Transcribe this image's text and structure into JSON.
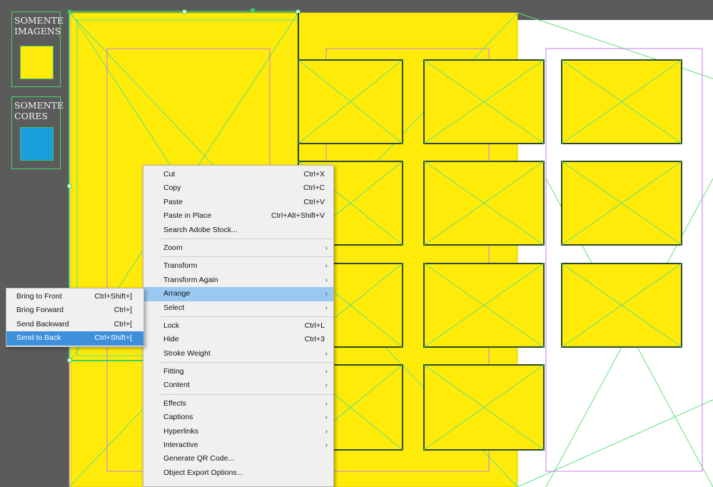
{
  "colors": {
    "pasteboard": "#5b5b5b",
    "page": "#ffffff",
    "frame_fill": "#ffeb0a",
    "frame_stroke": "#2a4a2a",
    "guide": "#5fe07f",
    "margin": "#c978f0",
    "cyan": "#19a0dc",
    "menu_bg": "#f0f0f0",
    "menu_highlight": "#99c8f0",
    "submenu_highlight": "#3d8fdc"
  },
  "swatches": {
    "images_label_line1": "SOMENTE",
    "images_label_line2": "IMAGENS",
    "colors_label_line1": "SOMENTE",
    "colors_label_line2": "CORES"
  },
  "context_menu": {
    "groups": [
      [
        {
          "label": "Cut",
          "shortcut": "Ctrl+X"
        },
        {
          "label": "Copy",
          "shortcut": "Ctrl+C"
        },
        {
          "label": "Paste",
          "shortcut": "Ctrl+V"
        },
        {
          "label": "Paste in Place",
          "shortcut": "Ctrl+Alt+Shift+V"
        },
        {
          "label": "Search Adobe Stock...",
          "shortcut": ""
        }
      ],
      [
        {
          "label": "Zoom",
          "submenu": true
        }
      ],
      [
        {
          "label": "Transform",
          "submenu": true
        },
        {
          "label": "Transform Again",
          "submenu": true
        },
        {
          "label": "Arrange",
          "submenu": true,
          "highlighted": true
        },
        {
          "label": "Select",
          "submenu": true
        }
      ],
      [
        {
          "label": "Lock",
          "shortcut": "Ctrl+L"
        },
        {
          "label": "Hide",
          "shortcut": "Ctrl+3"
        },
        {
          "label": "Stroke Weight",
          "submenu": true
        }
      ],
      [
        {
          "label": "Fitting",
          "submenu": true
        },
        {
          "label": "Content",
          "submenu": true
        }
      ],
      [
        {
          "label": "Effects",
          "submenu": true
        },
        {
          "label": "Captions",
          "submenu": true
        },
        {
          "label": "Hyperlinks",
          "submenu": true
        },
        {
          "label": "Interactive",
          "submenu": true
        },
        {
          "label": "Generate QR Code...",
          "shortcut": ""
        },
        {
          "label": "Object Export Options...",
          "shortcut": ""
        }
      ]
    ]
  },
  "arrange_submenu": [
    {
      "label": "Bring to Front",
      "shortcut": "Ctrl+Shift+]"
    },
    {
      "label": "Bring Forward",
      "shortcut": "Ctrl+]"
    },
    {
      "label": "Send Backward",
      "shortcut": "Ctrl+["
    },
    {
      "label": "Send to Back",
      "shortcut": "Ctrl+Shift+[",
      "highlighted": true
    }
  ],
  "icons": {
    "submenu_arrow": "›"
  }
}
